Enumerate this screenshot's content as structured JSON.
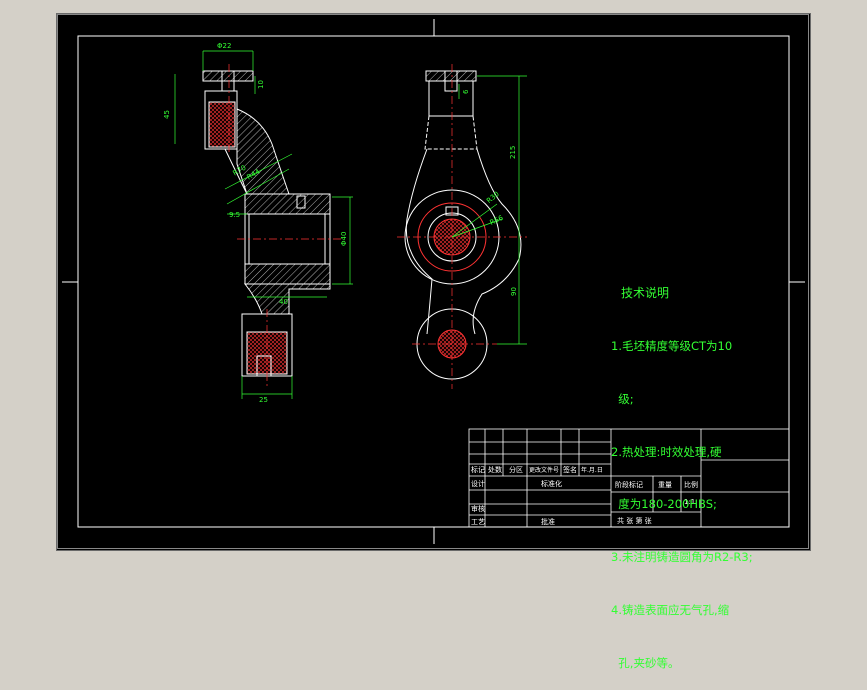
{
  "drawing": {
    "dims": {
      "d_top": "Φ22",
      "h_left": "45",
      "h_small": "10",
      "r_a": "R70",
      "r_b": "R44",
      "d_mid": "Φ40",
      "w_small": "9.5",
      "w_mid": "40",
      "w_bottom": "25",
      "d_right_top": "6",
      "h_right": "215",
      "r_c": "R30",
      "r_d": "R56",
      "h_right2": "90"
    },
    "tech_notes": {
      "title": "技术说明",
      "lines": [
        "1.毛坯精度等级CT为10",
        "  级;",
        "2.热处理:时效处理,硬",
        "  度为180-200HBS;",
        "3.未注明铸造圆角为R2-R3;",
        "4.铸造表面应无气孔,缩",
        "  孔,夹砂等。"
      ]
    },
    "title_block": {
      "row_labels": [
        "标记",
        "处数",
        "分区",
        "更改文件号",
        "签名",
        "年.月.日"
      ],
      "design": "设计",
      "standardize": "标准化",
      "review": "审核",
      "process": "工艺",
      "approve": "批准",
      "stage_mark": "阶段标记",
      "weight": "重量",
      "scale_label": "比例",
      "scale_value": "1:1",
      "sheets": "共  张 第  张"
    },
    "colors": {
      "outline": "#ffffff",
      "dimension": "#33ff33",
      "section": "#ff3333",
      "text": "#33ff33"
    }
  }
}
